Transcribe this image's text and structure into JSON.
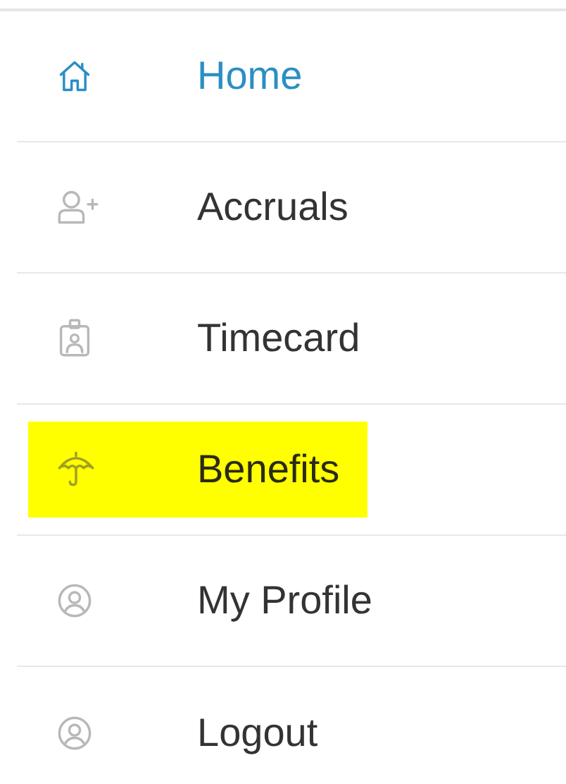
{
  "menu": {
    "items": [
      {
        "label": "Home",
        "selected": true,
        "highlighted": false
      },
      {
        "label": "Accruals",
        "selected": false,
        "highlighted": false
      },
      {
        "label": "Timecard",
        "selected": false,
        "highlighted": false
      },
      {
        "label": "Benefits",
        "selected": false,
        "highlighted": true
      },
      {
        "label": "My Profile",
        "selected": false,
        "highlighted": false
      },
      {
        "label": "Logout",
        "selected": false,
        "highlighted": false
      }
    ]
  }
}
